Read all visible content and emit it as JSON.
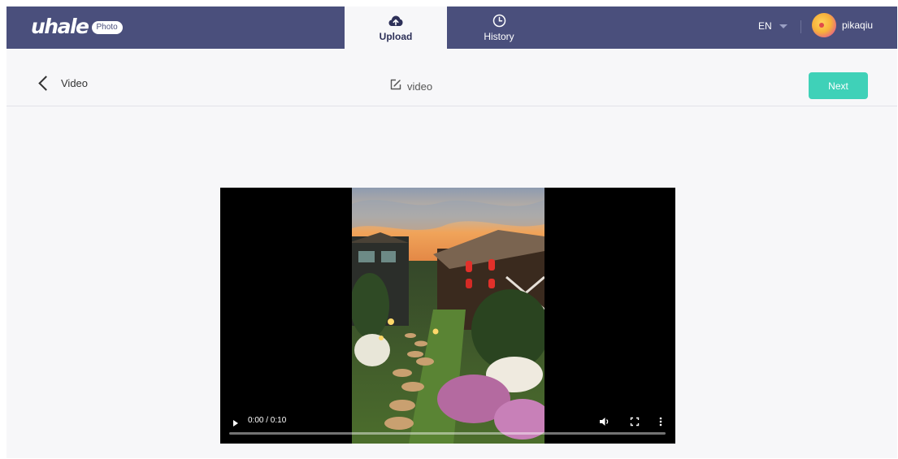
{
  "app": {
    "logo_text": "uhale",
    "logo_badge": "Photo"
  },
  "nav": {
    "tabs": [
      {
        "label": "Upload",
        "icon": "cloud-upload-icon",
        "active": true
      },
      {
        "label": "History",
        "icon": "clock-icon",
        "active": false
      }
    ],
    "language": "EN",
    "username": "pikaqiu"
  },
  "subheader": {
    "back_label": "Video",
    "title": "video",
    "next_label": "Next"
  },
  "player": {
    "time": "0:00 / 0:10",
    "progress": 0
  },
  "colors": {
    "nav_bg": "#4a4f7c",
    "accent": "#3fd1b8"
  }
}
